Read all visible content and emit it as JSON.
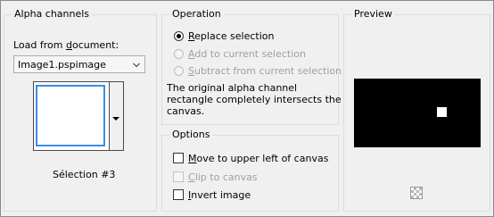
{
  "alpha_channels": {
    "title": "Alpha channels",
    "load_label_pre": "Load from ",
    "load_label_key": "d",
    "load_label_post": "ocument:",
    "document_value": "Image1.pspimage",
    "thumbnail_caption": "Sélection #3"
  },
  "operation": {
    "title": "Operation",
    "options": [
      {
        "key": "R",
        "rest": "eplace selection",
        "checked": true,
        "enabled": true
      },
      {
        "key": "A",
        "rest": "dd to current selection",
        "checked": false,
        "enabled": false
      },
      {
        "key": "S",
        "rest": "ubtract from current selection",
        "checked": false,
        "enabled": false
      }
    ],
    "message_line1": "The original alpha channel",
    "message_line2": "rectangle completely intersects the",
    "message_line3": "canvas."
  },
  "options": {
    "title": "Options",
    "items": [
      {
        "key": "M",
        "rest": "ove to upper left of canvas",
        "checked": false,
        "enabled": true
      },
      {
        "key": "C",
        "rest": "lip to canvas",
        "checked": false,
        "enabled": false
      },
      {
        "key": "I",
        "rest": "nvert image",
        "checked": false,
        "enabled": true
      }
    ]
  },
  "preview": {
    "title": "Preview",
    "canvas_color": "#000000",
    "selection_color": "#ffffff",
    "background_icon": "checkerboard-icon"
  }
}
